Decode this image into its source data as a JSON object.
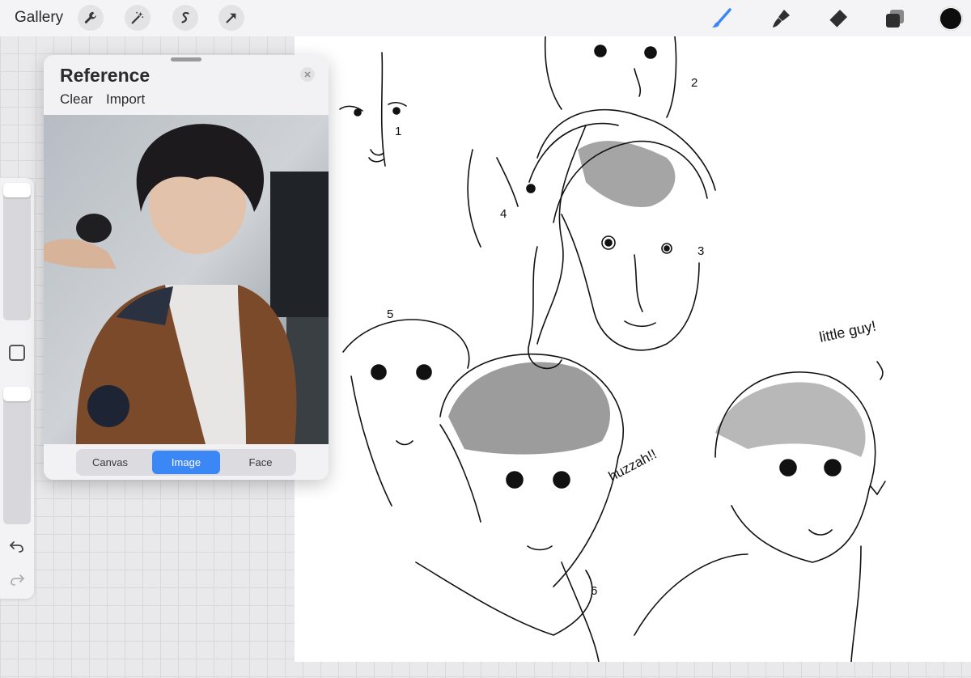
{
  "toolbar": {
    "gallery_label": "Gallery",
    "left_tools": [
      "wrench-icon",
      "magic-wand-icon",
      "selection-icon",
      "arrow-icon"
    ],
    "right_tools": [
      "brush-icon",
      "smudge-icon",
      "eraser-icon",
      "layers-icon"
    ],
    "active_tool": "brush-icon",
    "accent_color": "#3b87f5",
    "current_color": "#0d0d0d"
  },
  "reference": {
    "title": "Reference",
    "clear_label": "Clear",
    "import_label": "Import",
    "tabs": [
      {
        "label": "Canvas"
      },
      {
        "label": "Image"
      },
      {
        "label": "Face"
      }
    ],
    "active_tab": "Image"
  },
  "canvas": {
    "annotations": {
      "n1": "1",
      "n2": "2",
      "n3": "3",
      "n4": "4",
      "n5": "5",
      "n6": "6",
      "little_guy": "little guy!",
      "huzzah": "huzzah!!"
    }
  },
  "sidebar": {
    "undo_icon": "undo-icon",
    "redo_icon": "redo-icon"
  }
}
